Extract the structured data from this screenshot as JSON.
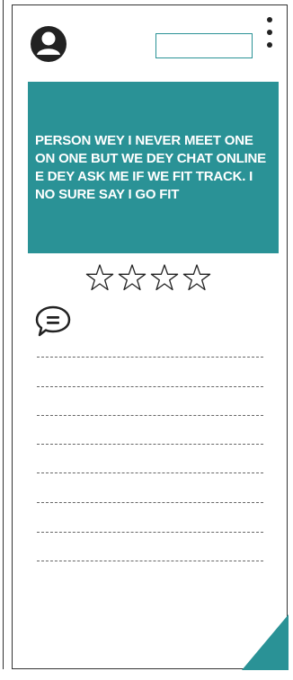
{
  "header": {
    "avatar_icon": "user-avatar-icon",
    "input_value": "",
    "menu_icon": "kebab-menu-icon"
  },
  "post": {
    "text": "PERSON WEY I NEVER MEET ONE ON ONE BUT WE DEY CHAT ONLINE E DEY ASK ME IF WE FIT TRACK. I NO SURE SAY I GO FIT",
    "background_color": "#2a9296",
    "text_color": "#ffffff"
  },
  "rating": {
    "max": 4,
    "value": 0,
    "icon": "star-outline-icon"
  },
  "comments": {
    "icon": "comment-bubble-icon",
    "placeholder_line_count": 8
  },
  "colors": {
    "accent": "#2a9296",
    "ink": "#222222"
  }
}
